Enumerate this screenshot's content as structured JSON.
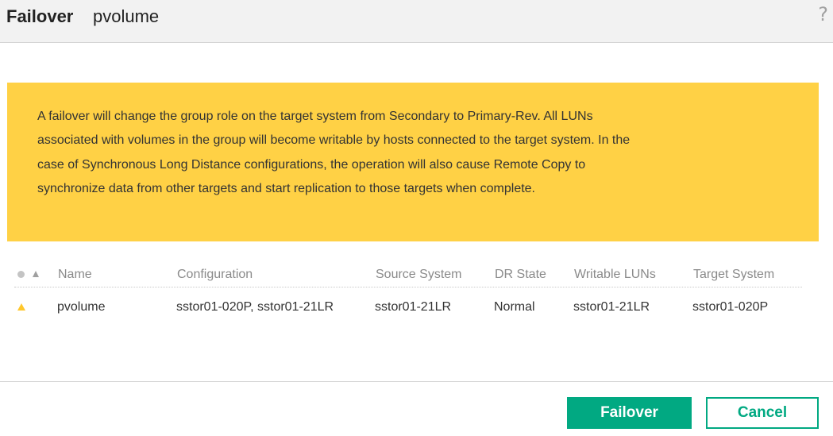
{
  "header": {
    "title_action": "Failover",
    "title_object": "pvolume",
    "help_glyph": "?"
  },
  "warning": {
    "message": "A failover will change the group role on the target system from Secondary to Primary-Rev. All LUNs associated with volumes in the group will become writable by hosts connected to the target system. In the case of Synchronous Long Distance configurations, the operation will also cause Remote Copy to synchronize data from other targets and start replication to those targets when complete.",
    "background_color": "#ffd145"
  },
  "table": {
    "columns": [
      "Name",
      "Configuration",
      "Source System",
      "DR State",
      "Writable LUNs",
      "Target System"
    ],
    "rows": [
      {
        "status_icon": "warning-triangle-icon",
        "name": "pvolume",
        "configuration": "sstor01-020P, sstor01-21LR",
        "source_system": "sstor01-21LR",
        "dr_state": "Normal",
        "writable_luns": "sstor01-21LR",
        "target_system": "sstor01-020P"
      }
    ]
  },
  "footer": {
    "primary_label": "Failover",
    "secondary_label": "Cancel",
    "accent_color": "#01a982"
  }
}
